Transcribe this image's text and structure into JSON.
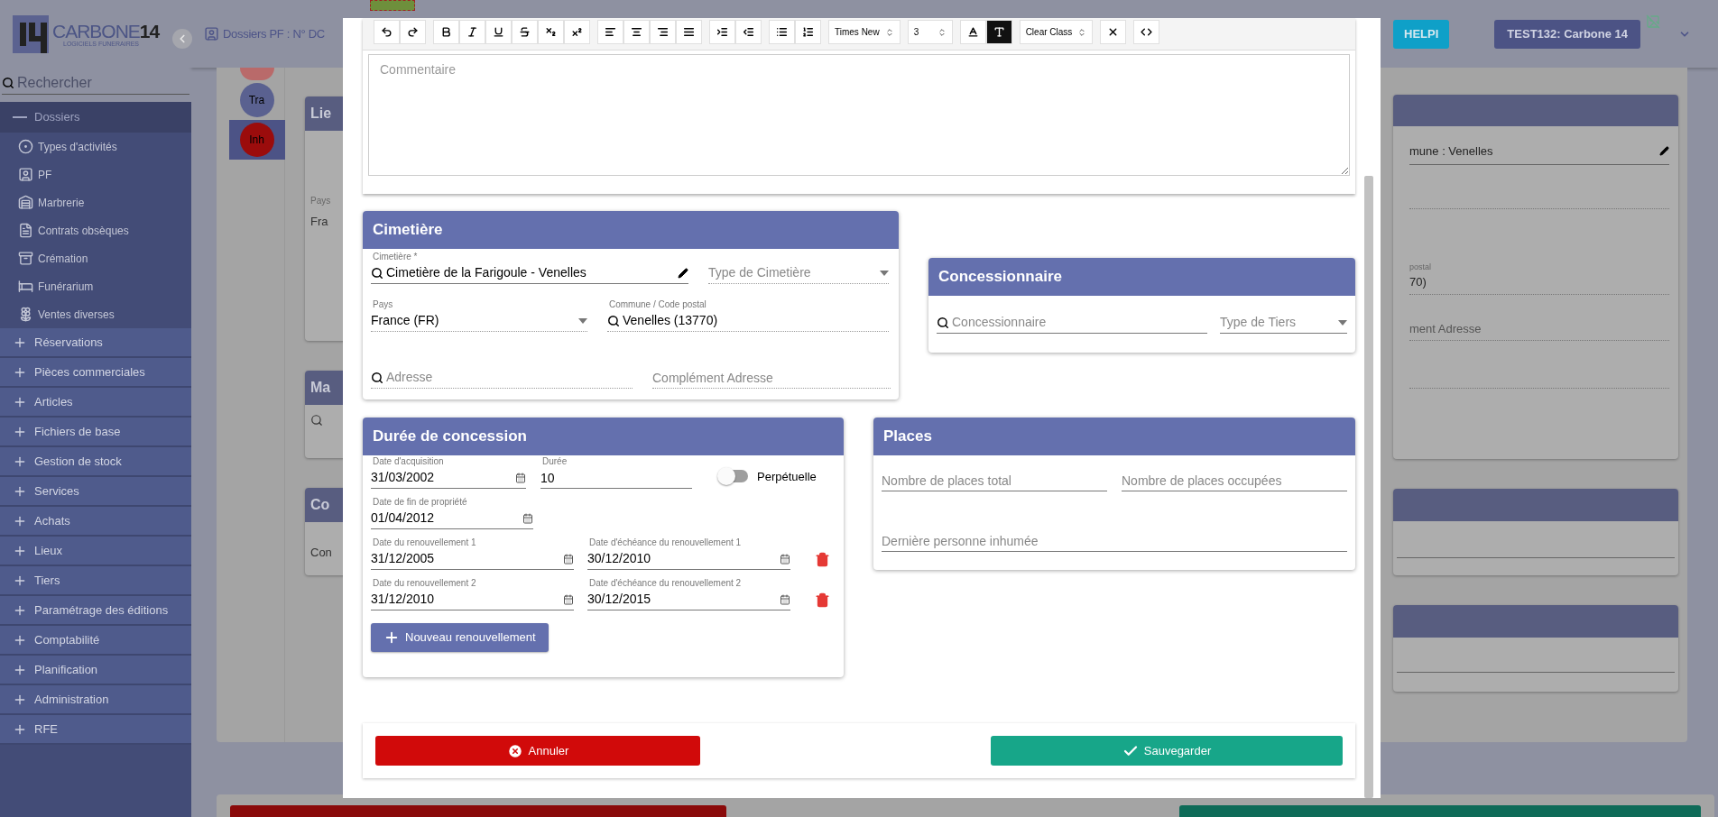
{
  "sidebar": {
    "logo": {
      "name": "CARBONE",
      "number": "14",
      "tagline": "LOGICIELS FUNERAIRES"
    },
    "search": {
      "placeholder": "Rechercher"
    },
    "groups": [
      {
        "label": "Dossiers",
        "expanded": true,
        "children": [
          {
            "label": "Types d'activités"
          },
          {
            "label": "PF"
          },
          {
            "label": "Marbrerie"
          },
          {
            "label": "Contrats obsèques"
          },
          {
            "label": "Crémation"
          },
          {
            "label": "Funérarium"
          },
          {
            "label": "Ventes diverses"
          }
        ]
      },
      {
        "label": "Réservations",
        "expanded": false
      },
      {
        "label": "Pièces commerciales",
        "expanded": false
      },
      {
        "label": "Articles",
        "expanded": false
      },
      {
        "label": "Fichiers de base",
        "expanded": false
      },
      {
        "label": "Gestion de stock",
        "expanded": false
      },
      {
        "label": "Services",
        "expanded": false
      },
      {
        "label": "Achats",
        "expanded": false
      },
      {
        "label": "Lieux",
        "expanded": false
      },
      {
        "label": "Tiers",
        "expanded": false
      },
      {
        "label": "Paramétrage des éditions",
        "expanded": false
      },
      {
        "label": "Comptabilité",
        "expanded": false
      },
      {
        "label": "Planification",
        "expanded": false
      },
      {
        "label": "Administration",
        "expanded": false
      },
      {
        "label": "RFE",
        "expanded": false
      }
    ]
  },
  "header": {
    "title": "Dossiers PF : N° DC",
    "help_button": "HELPI",
    "account_button": "TEST132: Carbone 14"
  },
  "timeline": [
    {
      "label": "Tra",
      "color": "#5a6190",
      "selected": false
    },
    {
      "label": "Inh",
      "color": "#9b0c0c",
      "selected": true
    }
  ],
  "background": {
    "left_cards": [
      {
        "title": "Lie",
        "field_label": "Pays",
        "field_value": "Fra"
      },
      {
        "title": "Ma"
      },
      {
        "title": "Co",
        "field_value": "Con"
      }
    ],
    "right_card": {
      "commune": "mune : Venelles",
      "postal_label": "postal",
      "postal_value": "70)",
      "address_placeholder": "ment Adresse"
    }
  },
  "modal": {
    "editor": {
      "placeholder": "Commentaire",
      "toolbar": [
        {
          "kind": "group",
          "tools": [
            {
              "kind": "undo"
            },
            {
              "kind": "redo"
            }
          ]
        },
        {
          "kind": "group",
          "tools": [
            {
              "kind": "bold"
            },
            {
              "kind": "italic"
            },
            {
              "kind": "underline"
            },
            {
              "kind": "strike"
            },
            {
              "kind": "subscript"
            },
            {
              "kind": "superscript"
            }
          ]
        },
        {
          "kind": "group",
          "tools": [
            {
              "kind": "alignleft"
            },
            {
              "kind": "aligncenter"
            },
            {
              "kind": "alignright"
            },
            {
              "kind": "justify"
            }
          ]
        },
        {
          "kind": "group",
          "tools": [
            {
              "kind": "indent"
            },
            {
              "kind": "outdent"
            }
          ]
        },
        {
          "kind": "group",
          "tools": [
            {
              "kind": "bullets"
            },
            {
              "kind": "numbers"
            }
          ]
        },
        {
          "kind": "select",
          "value": "Times New"
        },
        {
          "kind": "select",
          "value": "3"
        },
        {
          "kind": "group",
          "tools": [
            {
              "kind": "textcolor"
            },
            {
              "kind": "highlight"
            }
          ]
        },
        {
          "kind": "select",
          "value": "Clear Class"
        },
        {
          "kind": "group",
          "tools": [
            {
              "kind": "remove"
            }
          ]
        },
        {
          "kind": "group",
          "tools": [
            {
              "kind": "code"
            }
          ]
        }
      ]
    },
    "cemetery": {
      "title": "Cimetière",
      "rows": [
        [
          {
            "kind": "search",
            "label": "Cimetière *",
            "value": "Cimetière de la Farigoule - Venelles",
            "editable": true,
            "readonly": false
          },
          {
            "kind": "select",
            "placeholder": "Type de Cimetière",
            "readonly": true
          }
        ],
        [
          {
            "kind": "select",
            "label": "Pays",
            "value": "France (FR)",
            "readonly": true
          },
          {
            "kind": "search",
            "label": "Commune / Code postal",
            "value": "Venelles (13770)",
            "readonly": true
          }
        ],
        [
          {
            "kind": "search",
            "placeholder": "Adresse",
            "readonly": true
          },
          {
            "kind": "text",
            "placeholder": "Complément Adresse",
            "readonly": true
          }
        ]
      ]
    },
    "holder": {
      "title": "Concessionnaire",
      "rows": [
        [
          {
            "kind": "search",
            "placeholder": "Concessionnaire",
            "readonly": false
          },
          {
            "kind": "select",
            "placeholder": "Type de Tiers",
            "readonly": false
          }
        ]
      ]
    },
    "duration": {
      "title": "Durée de concession",
      "acquisition": {
        "kind": "date",
        "label": "Date d'acquisition",
        "value": "31/03/2002",
        "readonly": false
      },
      "length": {
        "kind": "text",
        "label": "Durée",
        "value": "10",
        "readonly": false
      },
      "perpetual": {
        "label": "Perpétuelle",
        "on": false
      },
      "end": {
        "kind": "date",
        "label": "Date de fin de propriété",
        "value": "01/04/2012",
        "readonly": false
      },
      "renewals": [
        [
          {
            "kind": "date",
            "label": "Date du renouvellement 1",
            "value": "31/12/2005",
            "readonly": false
          },
          {
            "kind": "date",
            "label": "Date d'échéance du renouvellement 1",
            "value": "30/12/2010",
            "readonly": false
          }
        ],
        [
          {
            "kind": "date",
            "label": "Date du renouvellement 2",
            "value": "31/12/2010",
            "readonly": false
          },
          {
            "kind": "date",
            "label": "Date d'échéance du renouvellement 2",
            "value": "30/12/2015",
            "readonly": false
          }
        ]
      ],
      "add_button": "Nouveau renouvellement"
    },
    "places": {
      "title": "Places",
      "rows": [
        [
          {
            "kind": "text",
            "placeholder": "Nombre de places total",
            "readonly": false
          },
          {
            "kind": "text",
            "placeholder": "Nombre de places occupées",
            "readonly": false
          }
        ],
        [
          {
            "kind": "text",
            "placeholder": "Dernière personne inhumée",
            "readonly": false
          }
        ]
      ]
    },
    "cancel_button": "Annuler",
    "save_button": "Sauvegarder"
  }
}
